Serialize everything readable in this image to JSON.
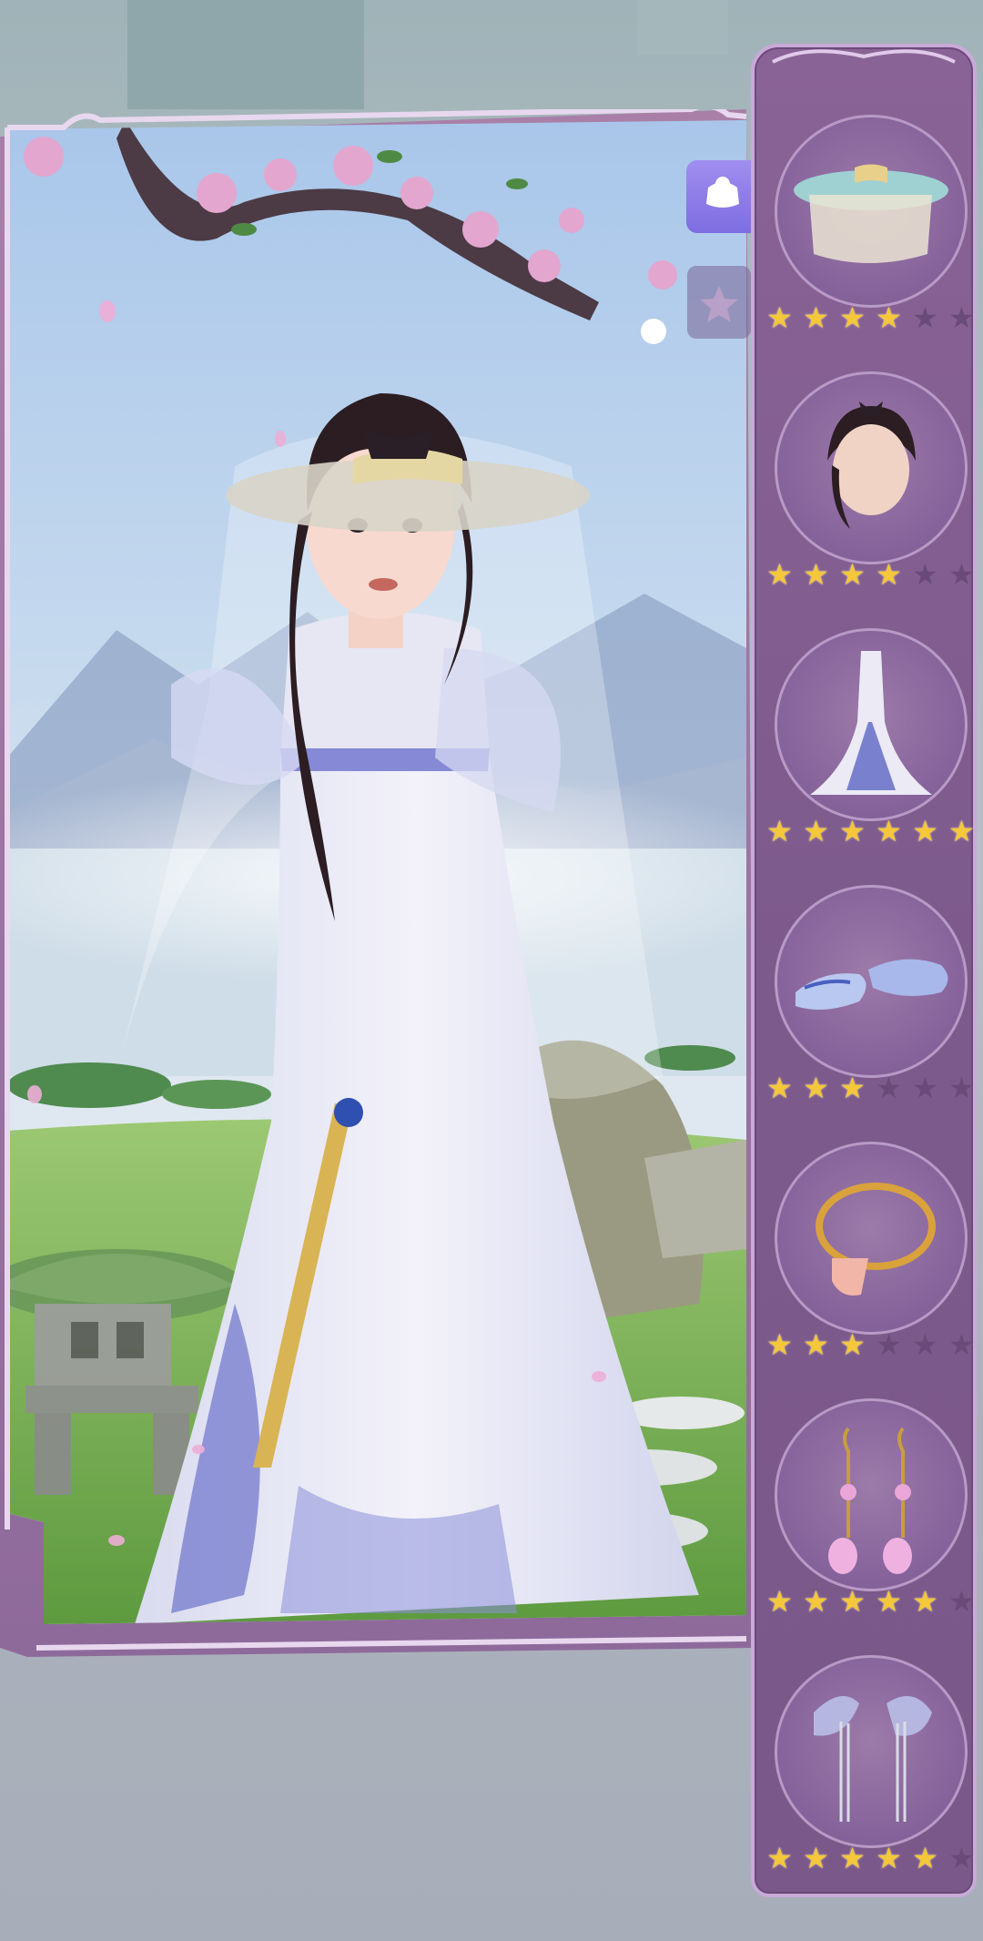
{
  "scene": {
    "character": "dress-up character in hanfu outfit",
    "colors": {
      "sky": "#b9d2ec",
      "grass": "#6aa247",
      "dress": "#e8e6f2",
      "accent_blue": "#6d73c8",
      "frame": "#8e6a9b",
      "star_on": "#f5c73a",
      "star_off": "#6a4a78"
    }
  },
  "selector": {
    "icon": "wardrobe-icon"
  },
  "filter": {
    "icon": "star-filter-icon"
  },
  "items": [
    {
      "slot": "hat",
      "icon": "veiled-hat-icon",
      "rating": 4,
      "max": 6
    },
    {
      "slot": "hair",
      "icon": "braided-hair-icon",
      "rating": 4,
      "max": 6
    },
    {
      "slot": "dress",
      "icon": "mermaid-gown-icon",
      "rating": 6,
      "max": 6
    },
    {
      "slot": "shoes",
      "icon": "embroidered-shoes-icon",
      "rating": 3,
      "max": 6
    },
    {
      "slot": "necklace",
      "icon": "pendant-necklace-icon",
      "rating": 3,
      "max": 6
    },
    {
      "slot": "earrings",
      "icon": "drop-earrings-icon",
      "rating": 5,
      "max": 6
    },
    {
      "slot": "hair-ornament",
      "icon": "hair-pins-icon",
      "rating": 5,
      "max": 6
    }
  ]
}
